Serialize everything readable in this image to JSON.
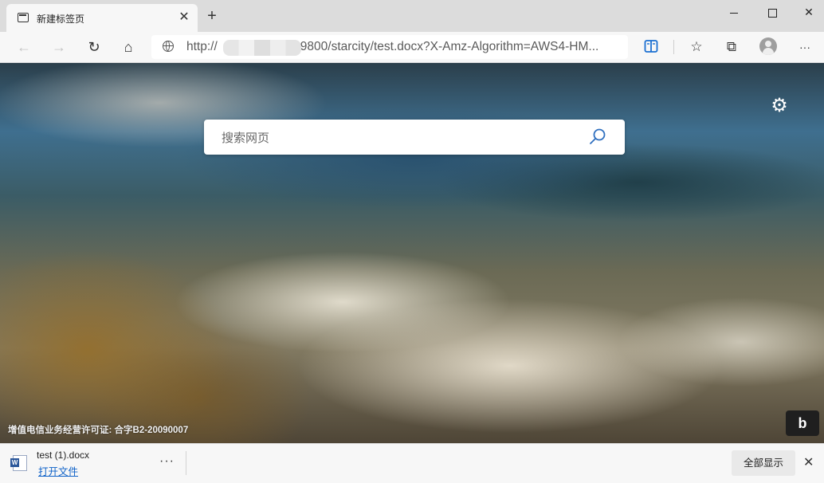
{
  "tab": {
    "title": "新建标签页",
    "close": "✕"
  },
  "titlebar": {
    "new_tab": "+",
    "close": "✕"
  },
  "toolbar": {
    "back": "←",
    "forward": "→",
    "refresh": "↻",
    "home": "⌂",
    "favorites": "☆",
    "collections": "⧉",
    "more": "···",
    "address": {
      "prefix": "http://",
      "rest": "9800/starcity/test.docx?X-Amz-Algorithm=AWS4-HM..."
    }
  },
  "content": {
    "search_placeholder": "搜索网页",
    "settings_glyph": "⚙",
    "legal_text": "增值电信业务经营许可证: 合字B2-20090007",
    "bing_glyph": "b"
  },
  "download": {
    "filename": "test (1).docx",
    "open_label": "打开文件",
    "more": "···",
    "show_all": "全部显示",
    "close": "✕",
    "file_badge": "W"
  }
}
